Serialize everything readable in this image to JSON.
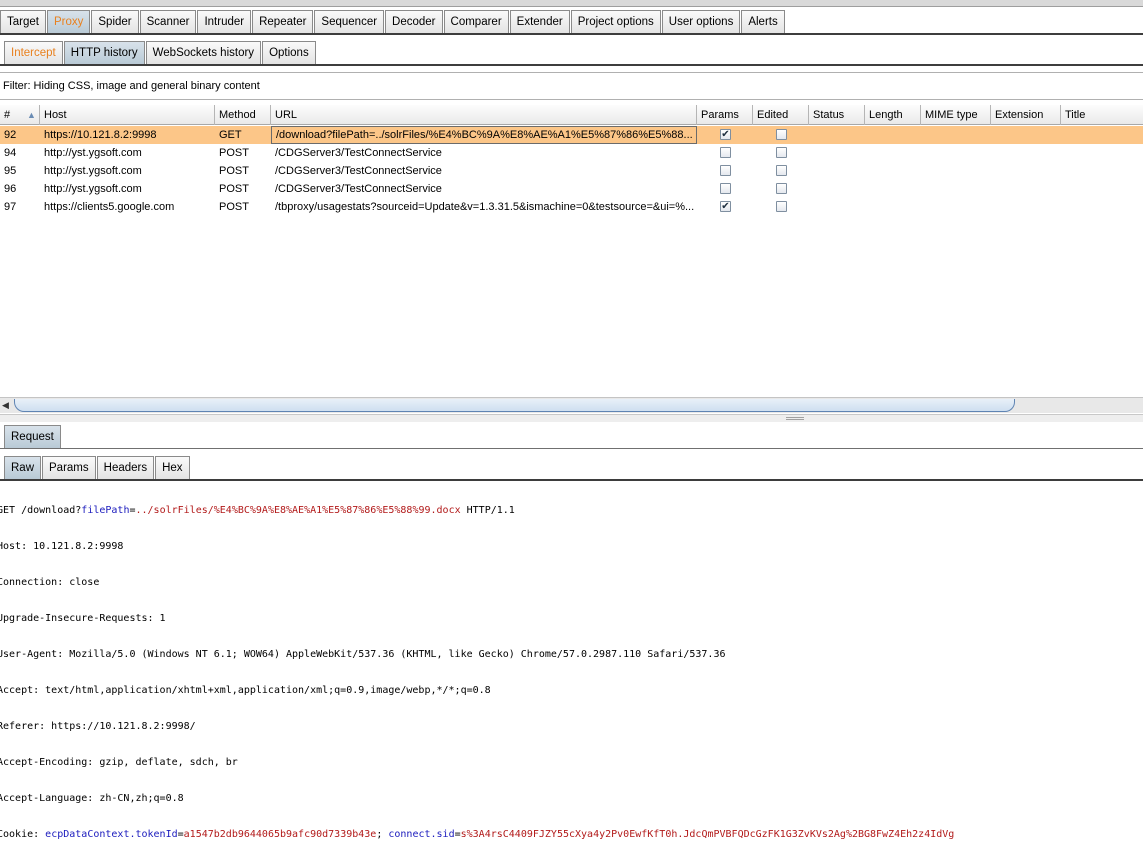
{
  "main_tabs": [
    "Target",
    "Proxy",
    "Spider",
    "Scanner",
    "Intruder",
    "Repeater",
    "Sequencer",
    "Decoder",
    "Comparer",
    "Extender",
    "Project options",
    "User options",
    "Alerts"
  ],
  "proxy_tabs": [
    "Intercept",
    "HTTP history",
    "WebSockets history",
    "Options"
  ],
  "filter_text": "Filter: Hiding CSS, image and general binary content",
  "columns": {
    "num": "#",
    "host": "Host",
    "method": "Method",
    "url": "URL",
    "params": "Params",
    "edited": "Edited",
    "status": "Status",
    "length": "Length",
    "mime": "MIME type",
    "extension": "Extension",
    "title": "Title"
  },
  "rows": [
    {
      "num": "92",
      "host": "https://10.121.8.2:9998",
      "method": "GET",
      "url": "/download?filePath=../solrFiles/%E4%BC%9A%E8%AE%A1%E5%87%86%E5%88...",
      "params": true,
      "edited": false,
      "selected": true
    },
    {
      "num": "94",
      "host": "http://yst.ygsoft.com",
      "method": "POST",
      "url": "/CDGServer3/TestConnectService",
      "params": false,
      "edited": false,
      "selected": false
    },
    {
      "num": "95",
      "host": "http://yst.ygsoft.com",
      "method": "POST",
      "url": "/CDGServer3/TestConnectService",
      "params": false,
      "edited": false,
      "selected": false
    },
    {
      "num": "96",
      "host": "http://yst.ygsoft.com",
      "method": "POST",
      "url": "/CDGServer3/TestConnectService",
      "params": false,
      "edited": false,
      "selected": false
    },
    {
      "num": "97",
      "host": "https://clients5.google.com",
      "method": "POST",
      "url": "/tbproxy/usagestats?sourceid=Update&v=1.3.31.5&ismachine=0&testsource=&ui=%...",
      "params": true,
      "edited": false,
      "selected": false
    }
  ],
  "request_tab": "Request",
  "view_tabs": [
    "Raw",
    "Params",
    "Headers",
    "Hex"
  ],
  "request": {
    "line1_a": "GET /download?",
    "line1_pname": "filePath",
    "line1_eq": "=",
    "line1_pval": "../solrFiles/%E4%BC%9A%E8%AE%A1%E5%87%86%E5%88%99.docx",
    "line1_b": " HTTP/1.1",
    "headers": [
      "Host: 10.121.8.2:9998",
      "Connection: close",
      "Upgrade-Insecure-Requests: 1",
      "User-Agent: Mozilla/5.0 (Windows NT 6.1; WOW64) AppleWebKit/537.36 (KHTML, like Gecko) Chrome/57.0.2987.110 Safari/537.36",
      "Accept: text/html,application/xhtml+xml,application/xml;q=0.9,image/webp,*/*;q=0.8",
      "Referer: https://10.121.8.2:9998/",
      "Accept-Encoding: gzip, deflate, sdch, br",
      "Accept-Language: zh-CN,zh;q=0.8"
    ],
    "cookie_label": "Cookie: ",
    "cookie1_name": "ecpDataContext.tokenId",
    "cookie1_eq": "=",
    "cookie1_val": "a1547b2db9644065b9afc90d7339b43e",
    "cookie_sep": "; ",
    "cookie2_name": "connect.sid",
    "cookie2_eq": "=",
    "cookie2_val": "s%3A4rsC4409FJZY55cXya4y2Pv0EwfKfT0h.JdcQmPVBFQDcGzFK1G3ZvKVs2Ag%2BG8FwZ4Eh2z4IdVg"
  }
}
